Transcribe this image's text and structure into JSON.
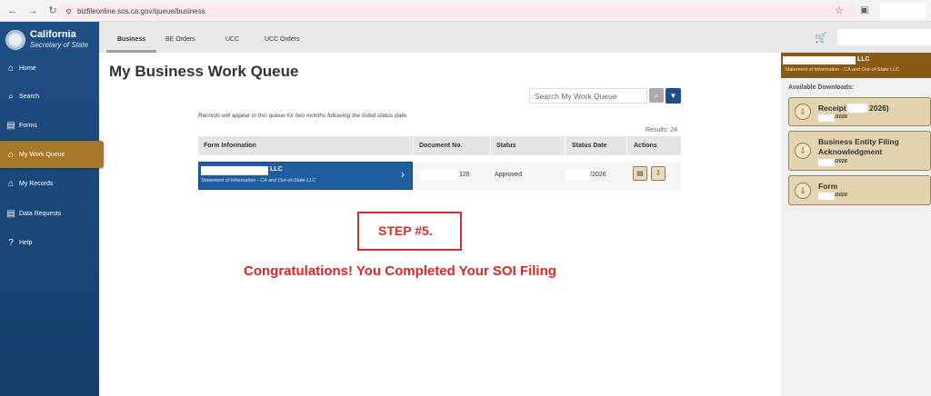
{
  "browser": {
    "url": "bizfileonline.sos.ca.gov/queue/business"
  },
  "brand": {
    "name": "California",
    "subtitle": "Secretary of State"
  },
  "sidebar": {
    "items": [
      {
        "label": "Home",
        "icon": "home-icon"
      },
      {
        "label": "Search",
        "icon": "search-icon"
      },
      {
        "label": "Forms",
        "icon": "forms-icon"
      },
      {
        "label": "My Work Queue",
        "icon": "work-queue-icon",
        "active": true
      },
      {
        "label": "My Records",
        "icon": "records-icon"
      },
      {
        "label": "Data Requests",
        "icon": "data-requests-icon"
      },
      {
        "label": "Help",
        "icon": "help-icon"
      }
    ]
  },
  "tabs": [
    {
      "label": "Business",
      "active": true
    },
    {
      "label": "BE Orders"
    },
    {
      "label": "UCC"
    },
    {
      "label": "UCC Orders"
    }
  ],
  "main": {
    "title": "My Business Work Queue",
    "search_placeholder": "Search My Work Queue",
    "note": "Records will appear in this queue for two months following the listed status date.",
    "results": "Results: 24",
    "columns": [
      "Form Information",
      "Document No.",
      "Status",
      "Status Date",
      "Actions"
    ],
    "row": {
      "name_suffix": "LLC",
      "form": "Statement of Information - CA and Out-of-State LLC",
      "doc_no": "126",
      "status": "Approved",
      "status_date": "/2026"
    }
  },
  "annotation": {
    "step": "STEP #5.",
    "message": "Congratulations! You Completed Your SOI Filing"
  },
  "right_panel": {
    "name_suffix": "LLC",
    "form": "Statement of Information - CA and Out-of-State LLC",
    "downloads_label": "Available Downloads:",
    "downloads": [
      {
        "title_a": "Receipt",
        "title_b": "2026)",
        "date": "/2026"
      },
      {
        "title_a": "Business Entity Filing",
        "title_b": "Acknowledgment",
        "date": "/2026"
      },
      {
        "title_a": "Form",
        "title_b": "",
        "date": "/2026"
      }
    ]
  },
  "colors": {
    "sidebar": "#1e4f85",
    "active_nav": "#a8782a",
    "row_highlight": "#1e5da0",
    "annotation": "#d92b2b"
  }
}
